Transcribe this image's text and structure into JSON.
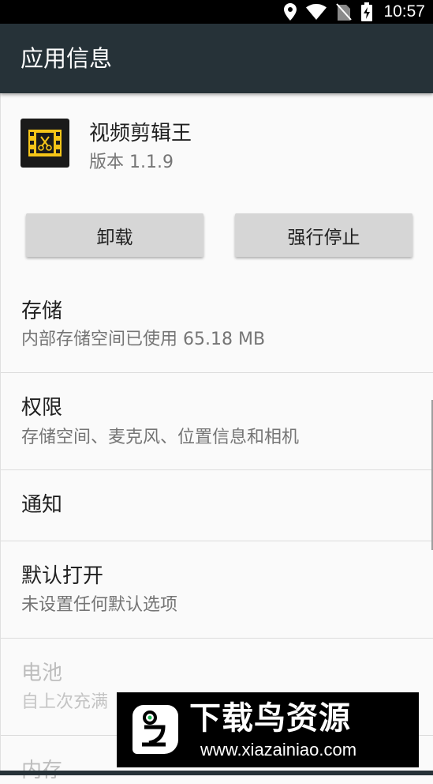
{
  "status_bar": {
    "time": "10:57",
    "icons": [
      "location-icon",
      "wifi-icon",
      "no-sim-icon",
      "battery-charging-icon"
    ]
  },
  "app_bar": {
    "title": "应用信息"
  },
  "app": {
    "name": "视频剪辑王",
    "version": "版本 1.1.9",
    "icon": "film-scissors-icon",
    "icon_colors": {
      "background": "#1a1a1a",
      "film": "#f5c518"
    }
  },
  "buttons": {
    "uninstall": "卸载",
    "force_stop": "强行停止"
  },
  "rows": [
    {
      "title": "存储",
      "subtitle": "内部存储空间已使用 65.18 MB",
      "enabled": true
    },
    {
      "title": "权限",
      "subtitle": "存储空间、麦克风、位置信息和相机",
      "enabled": true
    },
    {
      "title": "通知",
      "subtitle": "",
      "enabled": true
    },
    {
      "title": "默认打开",
      "subtitle": "未设置任何默认选项",
      "enabled": true
    },
    {
      "title": "电池",
      "subtitle": "自上次充满",
      "enabled": false
    },
    {
      "title": "内存",
      "subtitle": "",
      "enabled": false
    }
  ],
  "watermark": {
    "title": "下载鸟资源",
    "url": "www.xiazainiao.com"
  },
  "colors": {
    "app_bar": "#263238",
    "status_bar": "#000000",
    "button": "#d6d6d6"
  }
}
